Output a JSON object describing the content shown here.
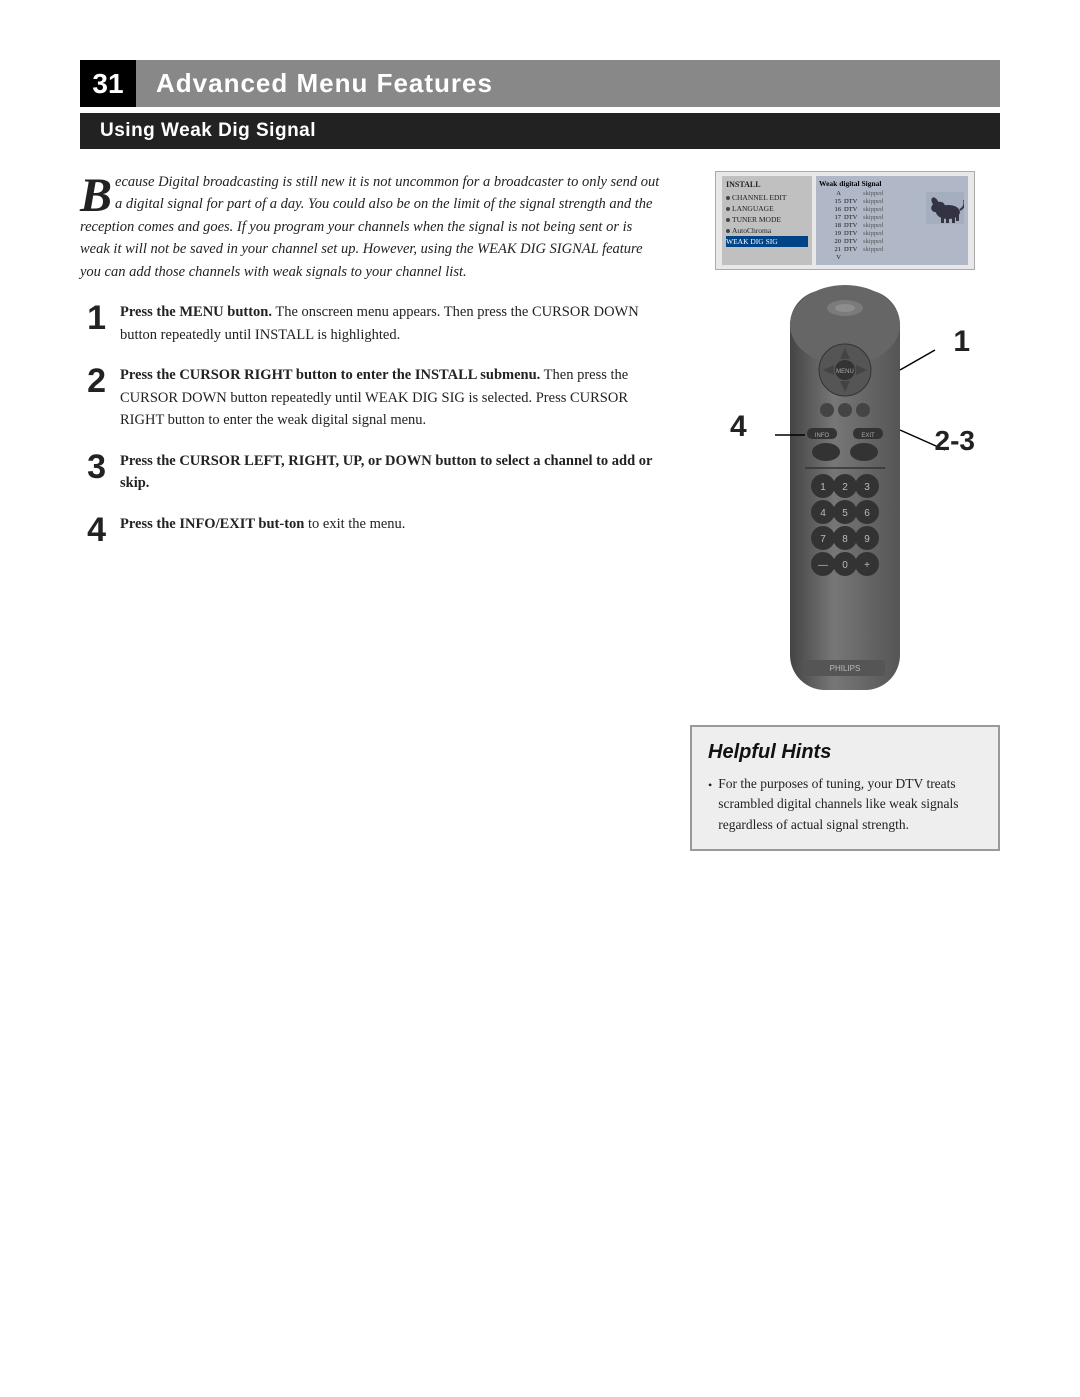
{
  "page": {
    "number": "31",
    "main_title": "Advanced Menu Features",
    "sub_title": "Using Weak Dig Signal"
  },
  "intro": {
    "drop_cap": "B",
    "text": "ecause Digital broadcasting is still new it is not uncommon for a broadcaster to only send out a digital signal for part of a day.  You could also be on the limit of the signal strength and the reception comes and goes.  If you program your channels when the signal is not being sent or is weak it will not be saved in your channel set up. However, using the WEAK DIG SIGNAL feature you can add those channels with weak signals to your channel list."
  },
  "steps": [
    {
      "number": "1",
      "title": "Press the MENU button.",
      "body": "The onscreen menu appears. Then press the CURSOR DOWN button repeatedly until INSTALL is highlighted."
    },
    {
      "number": "2",
      "title": "Press the CURSOR RIGHT button to enter the INSTALL submenu.",
      "body": "Then press the CURSOR DOWN button repeatedly until WEAK DIG SIG is selected. Press CURSOR RIGHT button to enter the weak digital signal menu."
    },
    {
      "number": "3",
      "title": "Press the CURSOR LEFT, RIGHT, UP, or DOWN button  to select a channel to add or skip.",
      "body": ""
    },
    {
      "number": "4",
      "title": "Press the INFO/EXIT but-ton",
      "body": "to exit the menu."
    }
  ],
  "screen": {
    "left_panel_title": "INSTALL",
    "menu_items": [
      "CHANNEL EDIT",
      "LANGUAGE",
      "TUNER MODE",
      "AutoChroma",
      "WEAK DIG SIG"
    ],
    "right_panel_title": "Weak digital Signal",
    "channels": [
      {
        "num": "A",
        "type": "",
        "status": "skipped"
      },
      {
        "num": "15",
        "type": "DTV",
        "status": "skipped"
      },
      {
        "num": "16",
        "type": "DTV",
        "status": "skipped"
      },
      {
        "num": "17",
        "type": "DTV",
        "status": "skipped"
      },
      {
        "num": "18",
        "type": "DTV",
        "status": "skipped"
      },
      {
        "num": "19",
        "type": "DTV",
        "status": "skipped"
      },
      {
        "num": "20",
        "type": "DTV",
        "status": "skipped"
      },
      {
        "num": "21",
        "type": "DTV",
        "status": "skipped"
      },
      {
        "num": "V",
        "type": "",
        "status": ""
      }
    ]
  },
  "callouts": {
    "c1": "1",
    "c23": "2-3",
    "c4": "4"
  },
  "helpful_hints": {
    "title": "Helpful Hints",
    "bullet": "For the purposes of tuning, your DTV treats scrambled digital channels like weak signals regardless of actual signal strength."
  }
}
